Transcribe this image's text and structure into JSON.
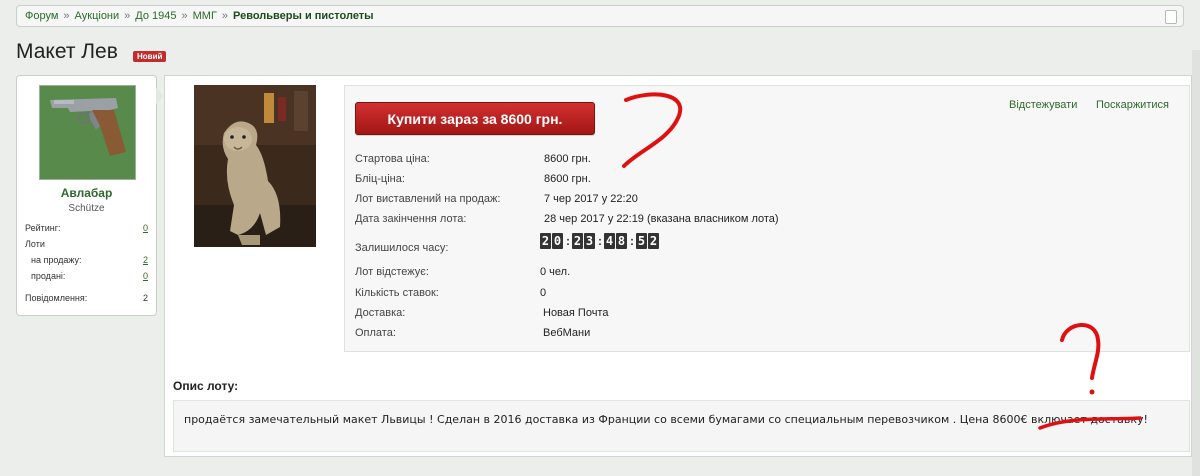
{
  "breadcrumb": {
    "items": [
      "Форум",
      "Аукціони",
      "До 1945",
      "ММГ"
    ],
    "current": "Револьверы и пистолеты",
    "separator": "»"
  },
  "thread": {
    "title": "Макет Лев",
    "badge": "Новий"
  },
  "user": {
    "name": "Авлабар",
    "rank": "Schütze",
    "stats": {
      "rating_label": "Рейтинг:",
      "rating_value": "0",
      "lots_label": "Лоти",
      "on_sale_label": "на продажу:",
      "on_sale_value": "2",
      "sold_label": "продані:",
      "sold_value": "0",
      "messages_label": "Повідомлення:",
      "messages_value": "2"
    }
  },
  "lot": {
    "buy_button": "Купити зараз за 8600 грн.",
    "follow_link": "Відстежувати",
    "report_link": "Поскаржитися",
    "rows": [
      {
        "label": "Стартова ціна:",
        "value": "8600 грн."
      },
      {
        "label": "Бліц-ціна:",
        "value": "8600 грн."
      },
      {
        "label": "Лот виставлений на продаж:",
        "value": "7 чер 2017 у 22:20"
      },
      {
        "label": "Дата закінчення лота:",
        "value": "28 чер 2017 у 22:19 (вказана власником лота)"
      }
    ],
    "time_left_label": "Залишилося часу:",
    "timer": [
      "20",
      "23",
      "48",
      "52"
    ],
    "rows2": [
      {
        "label": "Лот відстежує:",
        "value": "0 чел."
      },
      {
        "label": "Кількість ставок:",
        "value": "0"
      },
      {
        "label": "Доставка:",
        "value": "Новая Почта"
      },
      {
        "label": "Оплата:",
        "value": "ВебМани"
      }
    ]
  },
  "description": {
    "title": "Опис лоту:",
    "text": "продаётся замечательный макет Львицы ! Сделан в 2016 доставка из Франции со всеми бумагами со специальным перевозчиком . Цена 8600€ включает доставку!"
  },
  "colors": {
    "accent_green": "#2d6a2d",
    "buy_red": "#c02222",
    "annotation_red": "#e01010",
    "badge_red": "#c12c2c"
  }
}
